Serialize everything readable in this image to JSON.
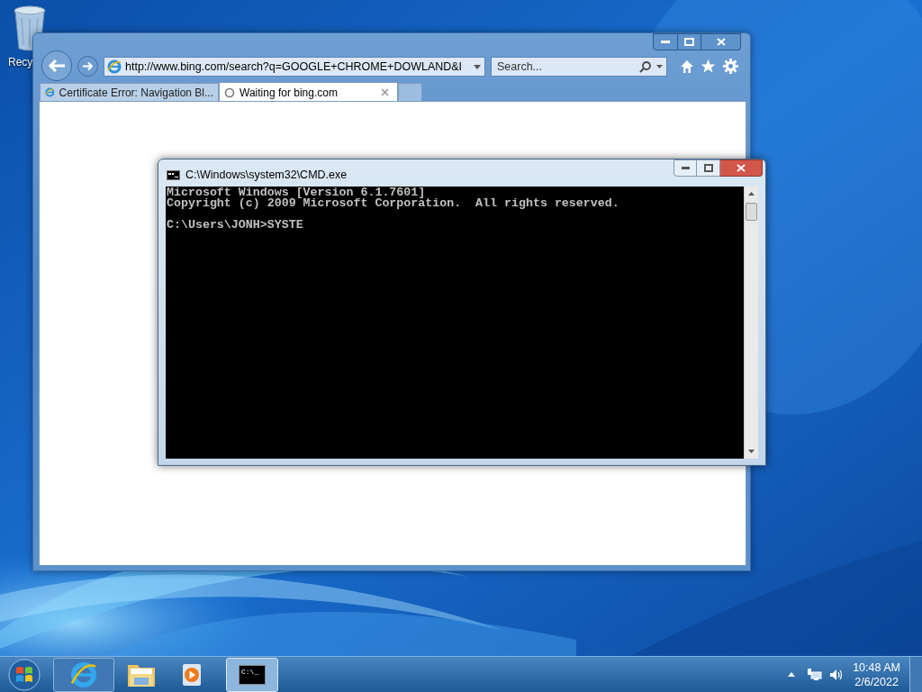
{
  "desktop": {
    "icons": [
      {
        "label": "Recy"
      }
    ]
  },
  "browser": {
    "address": "http://www.bing.com/search?q=GOOGLE+CHROME+DOWLAND&I",
    "search": {
      "placeholder": "Search..."
    },
    "tabs": [
      {
        "label": "Certificate Error: Navigation Bl...",
        "selected": false,
        "kind": "page"
      },
      {
        "label": "Waiting for bing.com",
        "selected": true,
        "kind": "loading"
      }
    ]
  },
  "console": {
    "title": "C:\\Windows\\system32\\CMD.exe",
    "blocks": [
      [
        "Microsoft Windows [Version 6.1.7601]",
        "Copyright (c) 2009 Microsoft Corporation.  All rights reserved."
      ],
      [
        "C:\\Users\\JONH>SYSTE"
      ]
    ]
  },
  "taskbar": {
    "buttons": [
      {
        "kind": "browser",
        "running": true,
        "selected": false
      },
      {
        "kind": "folder",
        "running": false,
        "selected": false
      },
      {
        "kind": "media",
        "running": false,
        "selected": false
      },
      {
        "kind": "console",
        "running": true,
        "selected": true,
        "icon_text": "C:\\_"
      }
    ],
    "clock": {
      "time": "10:48 AM",
      "date": "2/6/2022"
    }
  }
}
